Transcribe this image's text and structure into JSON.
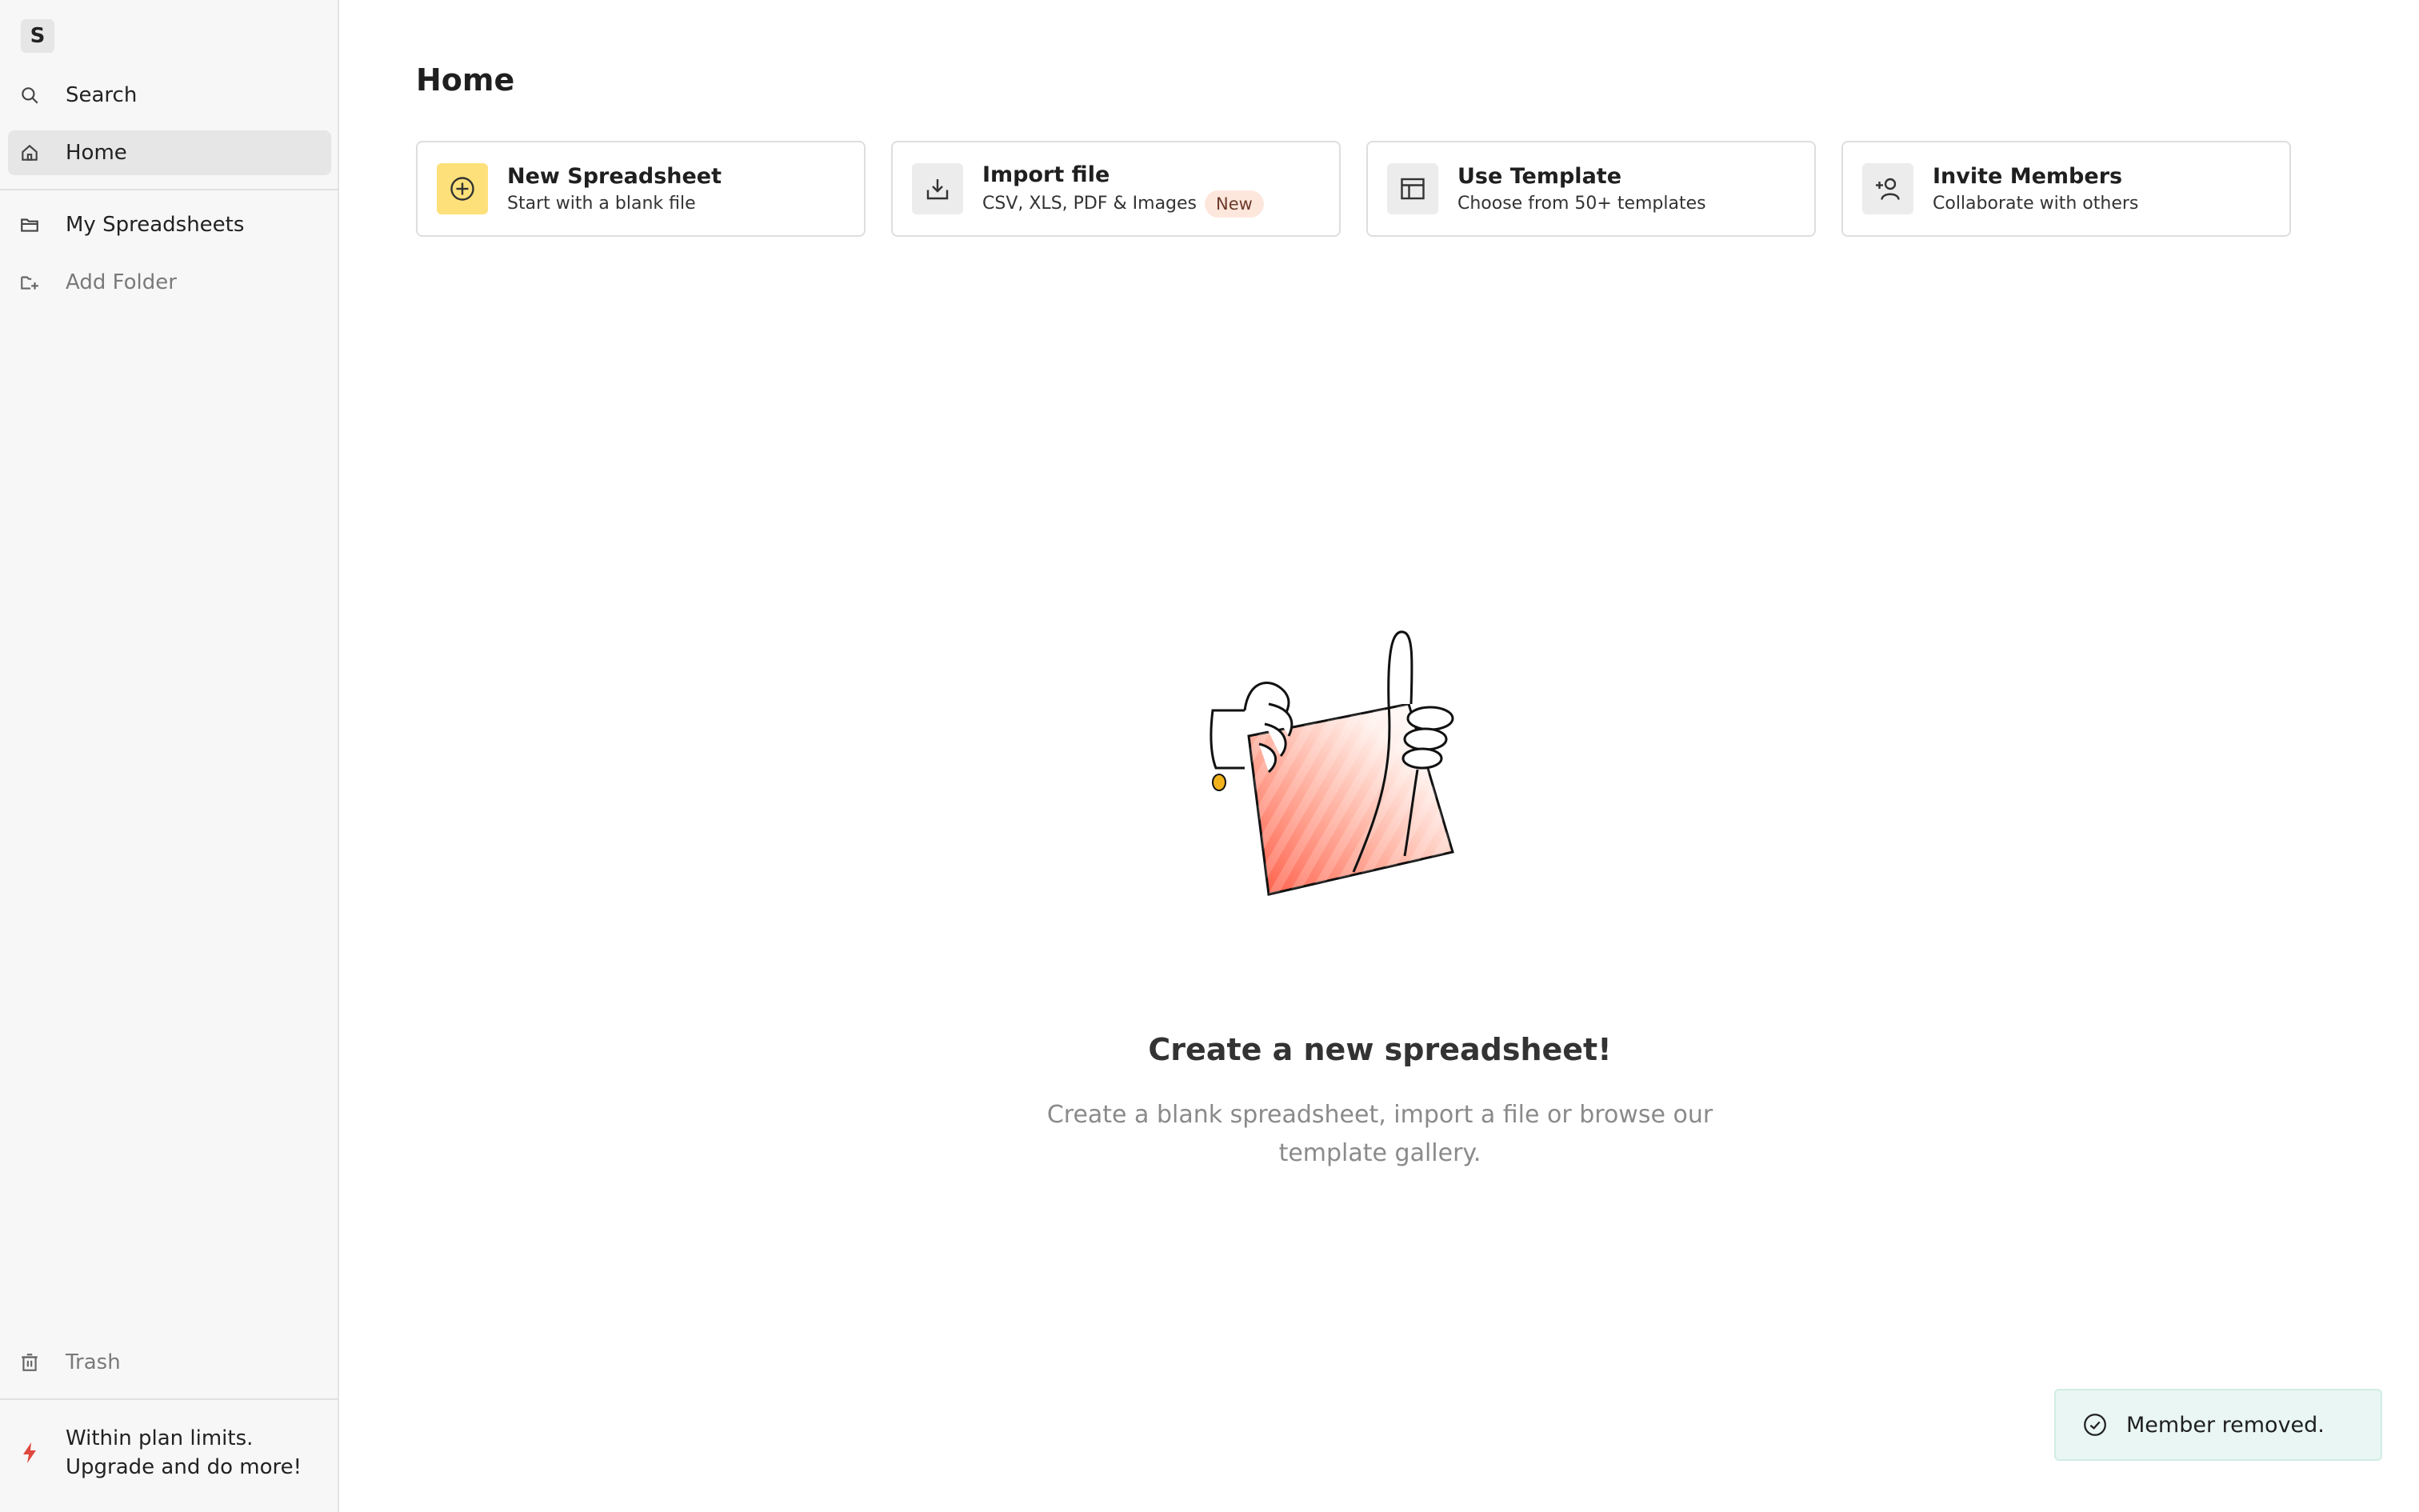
{
  "workspace": {
    "initial": "S"
  },
  "sidebar": {
    "search_label": "Search",
    "home_label": "Home",
    "my_spreadsheets_label": "My Spreadsheets",
    "add_folder_label": "Add Folder",
    "trash_label": "Trash",
    "upgrade_line1": "Within plan limits.",
    "upgrade_line2": "Upgrade and do more!"
  },
  "main": {
    "title": "Home",
    "cards": [
      {
        "title": "New Spreadsheet",
        "subtitle": "Start with a blank file",
        "icon": "plus-circle-icon"
      },
      {
        "title": "Import file",
        "subtitle": "CSV, XLS, PDF & Images",
        "badge": "New",
        "icon": "download-icon"
      },
      {
        "title": "Use Template",
        "subtitle": "Choose from 50+ templates",
        "icon": "template-icon"
      },
      {
        "title": "Invite Members",
        "subtitle": "Collaborate with others",
        "icon": "add-user-icon"
      }
    ],
    "empty_state": {
      "title": "Create a new spreadsheet!",
      "description": "Create a blank spreadsheet, import a file or browse our template gallery."
    }
  },
  "toast": {
    "message": "Member removed."
  },
  "colors": {
    "accent_yellow": "#fde07a",
    "badge_bg": "#fde7dc",
    "toast_bg": "#e9f6f3",
    "upgrade_icon": "#e0483e",
    "illustration_red": "#ff6a55"
  }
}
